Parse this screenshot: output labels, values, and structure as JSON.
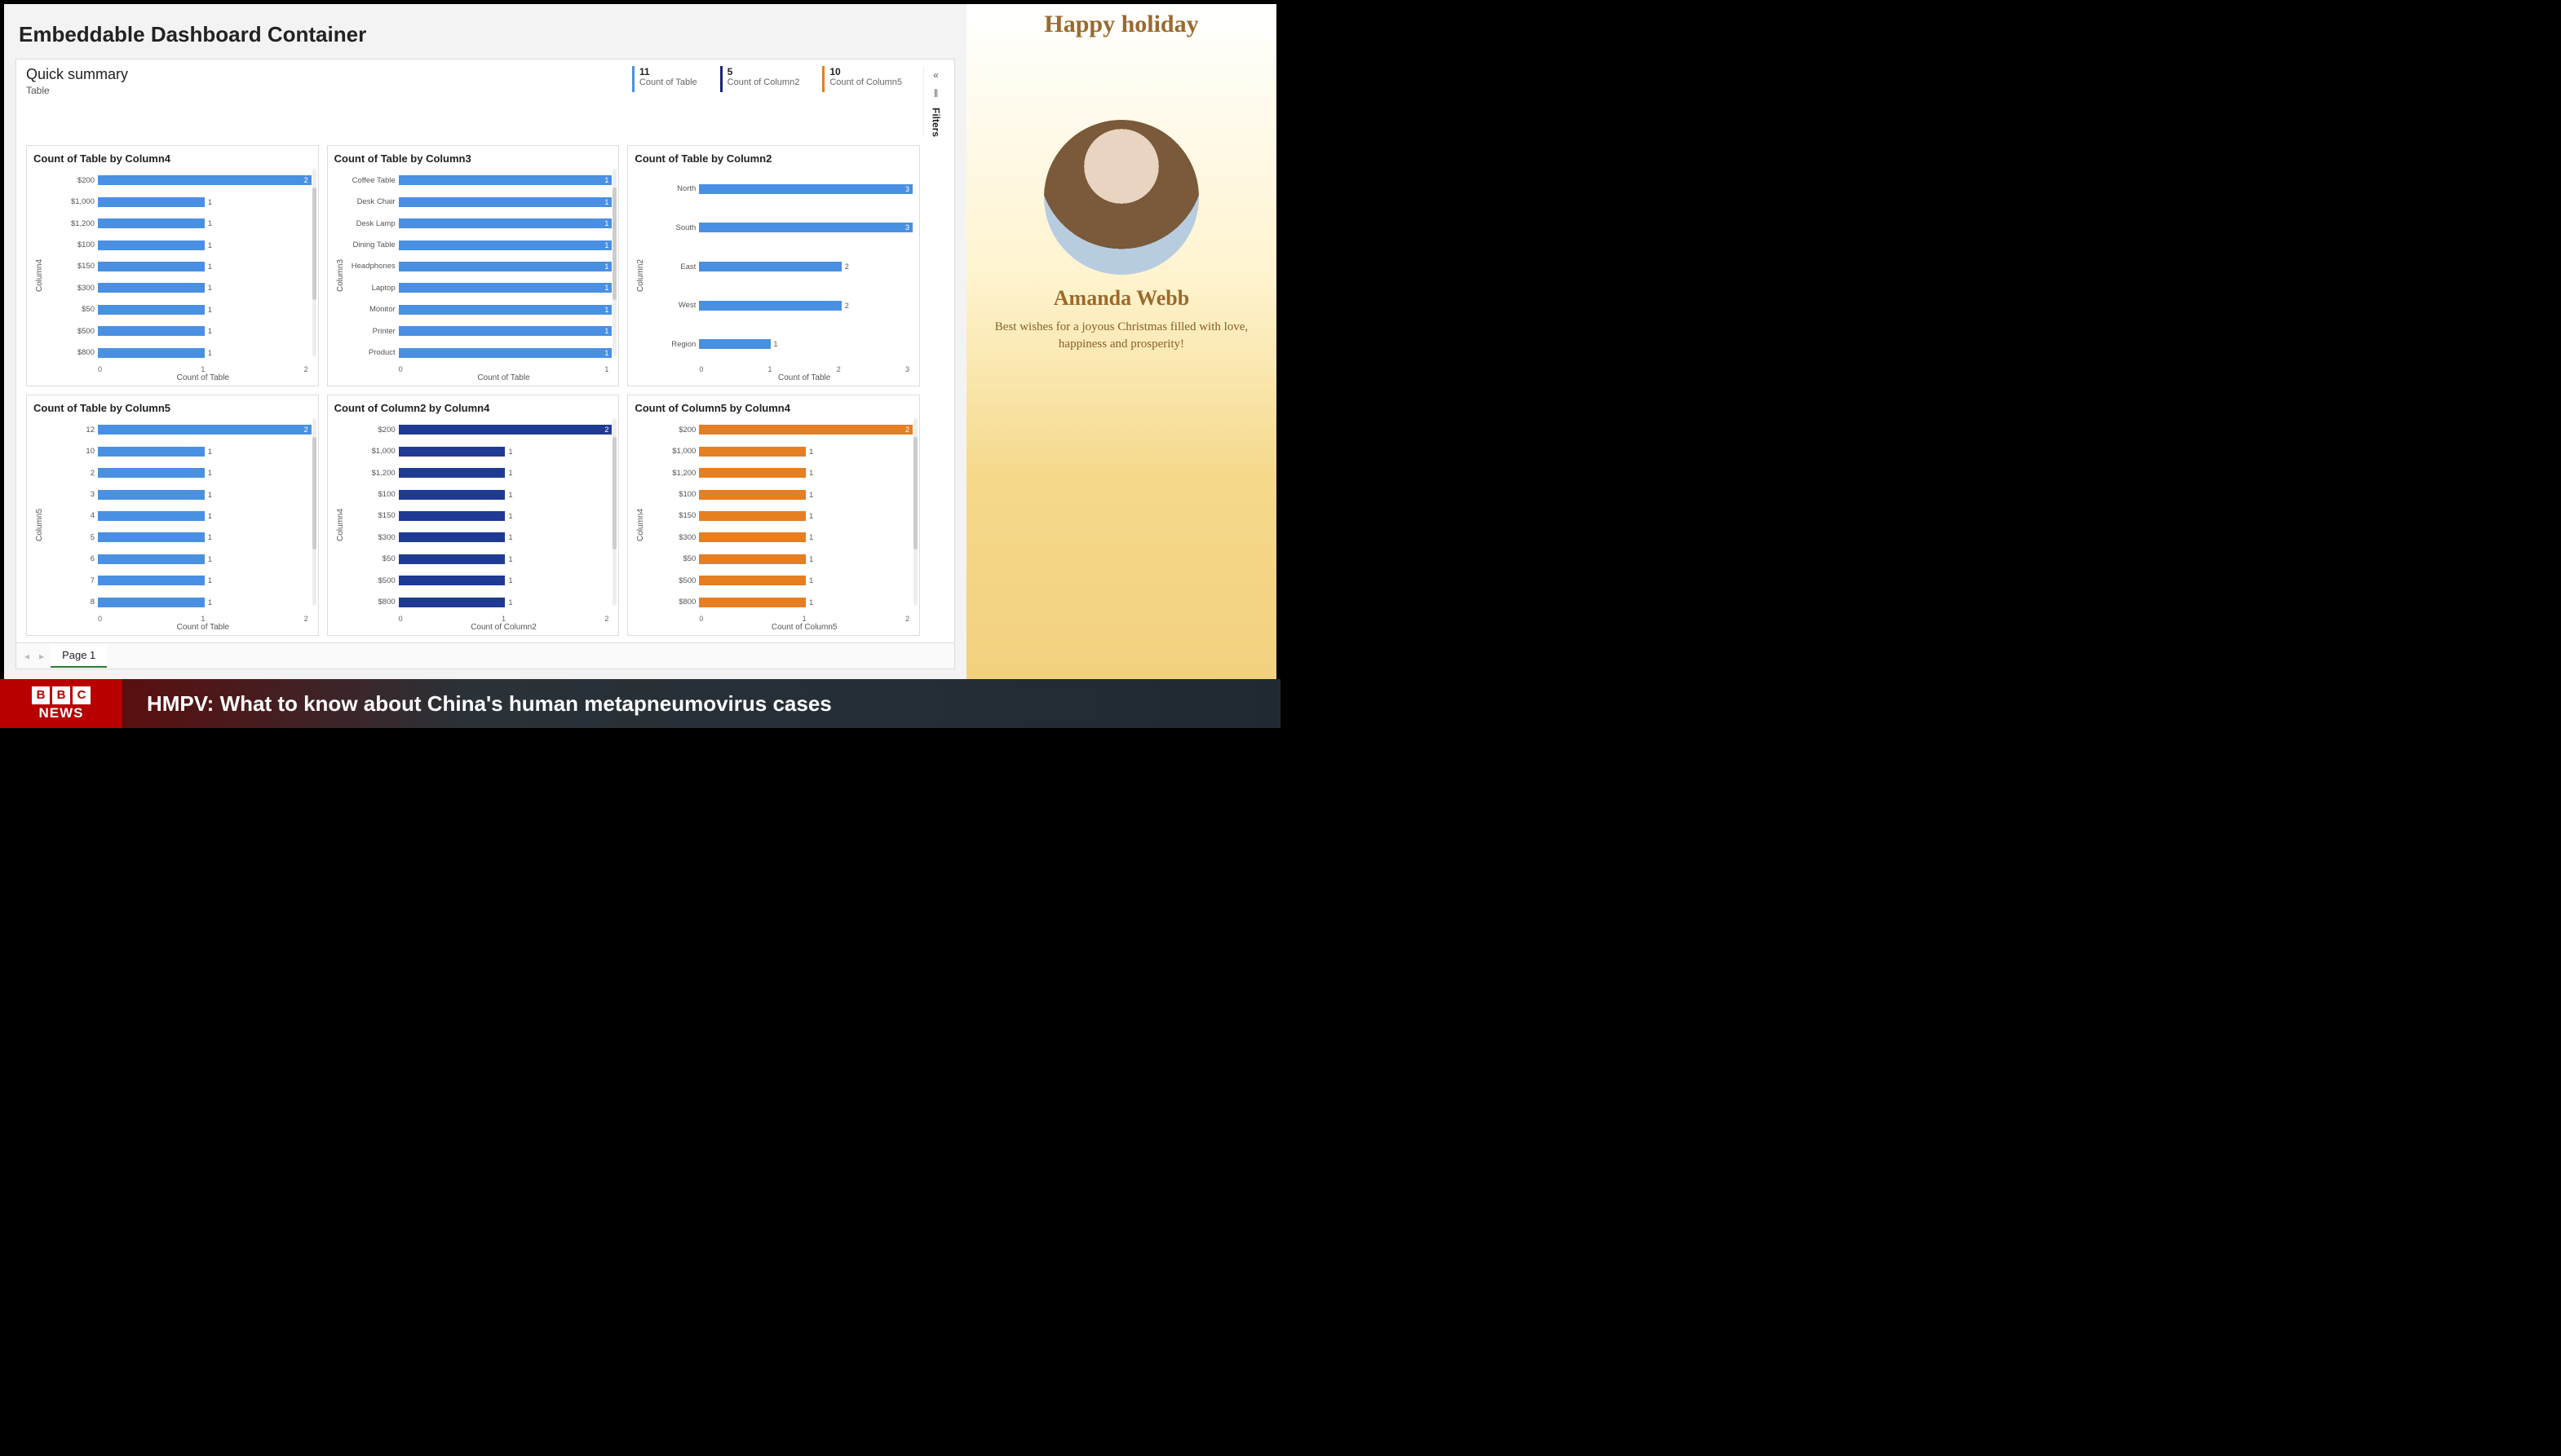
{
  "dashboard": {
    "title": "Embeddable Dashboard Container",
    "quick_summary": {
      "title": "Quick summary",
      "subtitle": "Table"
    },
    "kpis": [
      {
        "value": "11",
        "label": "Count of Table",
        "color": "blue"
      },
      {
        "value": "5",
        "label": "Count of Column2",
        "color": "navy"
      },
      {
        "value": "10",
        "label": "Count of Column5",
        "color": "orange"
      }
    ],
    "filters_label": "Filters",
    "page_tab": "Page 1"
  },
  "chart_data": [
    {
      "id": "c1",
      "type": "bar",
      "color": "blue",
      "title": "Count of Table by Column4",
      "ylabel": "Column4",
      "xlabel": "Count of Table",
      "xlim": [
        0,
        2
      ],
      "categories": [
        "$200",
        "$1,000",
        "$1,200",
        "$100",
        "$150",
        "$300",
        "$50",
        "$500",
        "$800"
      ],
      "values": [
        2,
        1,
        1,
        1,
        1,
        1,
        1,
        1,
        1
      ],
      "ticks": [
        "0",
        "1",
        "2"
      ],
      "scroll": true
    },
    {
      "id": "c2",
      "type": "bar",
      "color": "blue",
      "title": "Count of Table by Column3",
      "ylabel": "Column3",
      "xlabel": "Count of Table",
      "xlim": [
        0,
        1
      ],
      "categories": [
        "Coffee Table",
        "Desk Chair",
        "Desk Lamp",
        "Dining Table",
        "Headphones",
        "Laptop",
        "Monitor",
        "Printer",
        "Product"
      ],
      "values": [
        1,
        1,
        1,
        1,
        1,
        1,
        1,
        1,
        1
      ],
      "ticks": [
        "0",
        "1"
      ],
      "scroll": true
    },
    {
      "id": "c3",
      "type": "bar",
      "color": "blue",
      "title": "Count of Table by Column2",
      "ylabel": "Column2",
      "xlabel": "Count of Table",
      "xlim": [
        0,
        3
      ],
      "categories": [
        "North",
        "South",
        "East",
        "West",
        "Region"
      ],
      "values": [
        3,
        3,
        2,
        2,
        1
      ],
      "ticks": [
        "0",
        "1",
        "2",
        "3"
      ],
      "scroll": false
    },
    {
      "id": "c4",
      "type": "bar",
      "color": "blue",
      "title": "Count of Table by Column5",
      "ylabel": "Column5",
      "xlabel": "Count of Table",
      "xlim": [
        0,
        2
      ],
      "categories": [
        "12",
        "10",
        "2",
        "3",
        "4",
        "5",
        "6",
        "7",
        "8"
      ],
      "values": [
        2,
        1,
        1,
        1,
        1,
        1,
        1,
        1,
        1
      ],
      "ticks": [
        "0",
        "1",
        "2"
      ],
      "scroll": true
    },
    {
      "id": "c5",
      "type": "bar",
      "color": "navy",
      "title": "Count of Column2 by Column4",
      "ylabel": "Column4",
      "xlabel": "Count of Column2",
      "xlim": [
        0,
        2
      ],
      "categories": [
        "$200",
        "$1,000",
        "$1,200",
        "$100",
        "$150",
        "$300",
        "$50",
        "$500",
        "$800"
      ],
      "values": [
        2,
        1,
        1,
        1,
        1,
        1,
        1,
        1,
        1
      ],
      "ticks": [
        "0",
        "1",
        "2"
      ],
      "scroll": true
    },
    {
      "id": "c6",
      "type": "bar",
      "color": "orange",
      "title": "Count of Column5 by Column4",
      "ylabel": "Column4",
      "xlabel": "Count of Column5",
      "xlim": [
        0,
        2
      ],
      "categories": [
        "$200",
        "$1,000",
        "$1,200",
        "$100",
        "$150",
        "$300",
        "$50",
        "$500",
        "$800"
      ],
      "values": [
        2,
        1,
        1,
        1,
        1,
        1,
        1,
        1,
        1
      ],
      "ticks": [
        "0",
        "1",
        "2"
      ],
      "scroll": true
    }
  ],
  "card": {
    "title": "Happy holiday",
    "name": "Amanda Webb",
    "message": "Best wishes for a joyous Christmas filled with love, happiness and prosperity!"
  },
  "news": {
    "logo_word": "NEWS",
    "headline": "HMPV: What to know about China's human metapneumovirus cases"
  }
}
